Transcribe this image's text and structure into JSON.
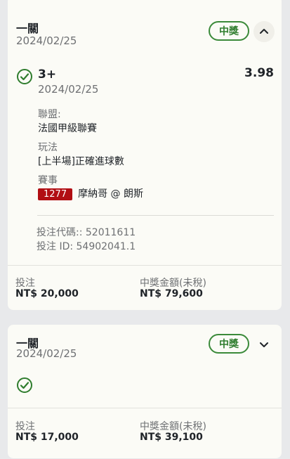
{
  "cards": [
    {
      "title": "一關",
      "date": "2024/02/25",
      "status": "中獎",
      "expanded": true,
      "selection": {
        "name": "3+",
        "date": "2024/02/25",
        "odds": "3.98",
        "league_label": "聯盟:",
        "league": "法國甲級聯賽",
        "market_label": "玩法",
        "market": "[上半場]正確進球數",
        "event_label": "賽事",
        "event_code": "1277",
        "event_name": "摩納哥 @ 朗斯"
      },
      "bet_code": "投注代碼:: 52011611",
      "bet_id": "投注 ID: 54902041.1",
      "stake_label": "投注",
      "stake": "NT$ 20,000",
      "payout_label": "中獎金額(未稅)",
      "payout": "NT$ 79,600"
    },
    {
      "title": "一關",
      "date": "2024/02/25",
      "status": "中獎",
      "expanded": false,
      "stake_label": "投注",
      "stake": "NT$ 17,000",
      "payout_label": "中獎金額(未稅)",
      "payout": "NT$ 39,100"
    }
  ],
  "colors": {
    "win": "#2f7d2e",
    "event_badge": "#b10e13",
    "card_bg": "#fbfbf6",
    "page_bg": "#e8e9eb"
  },
  "icons": {
    "collapse": "chevron-up-icon",
    "expand": "chevron-down-icon",
    "won": "check-circle-icon"
  }
}
